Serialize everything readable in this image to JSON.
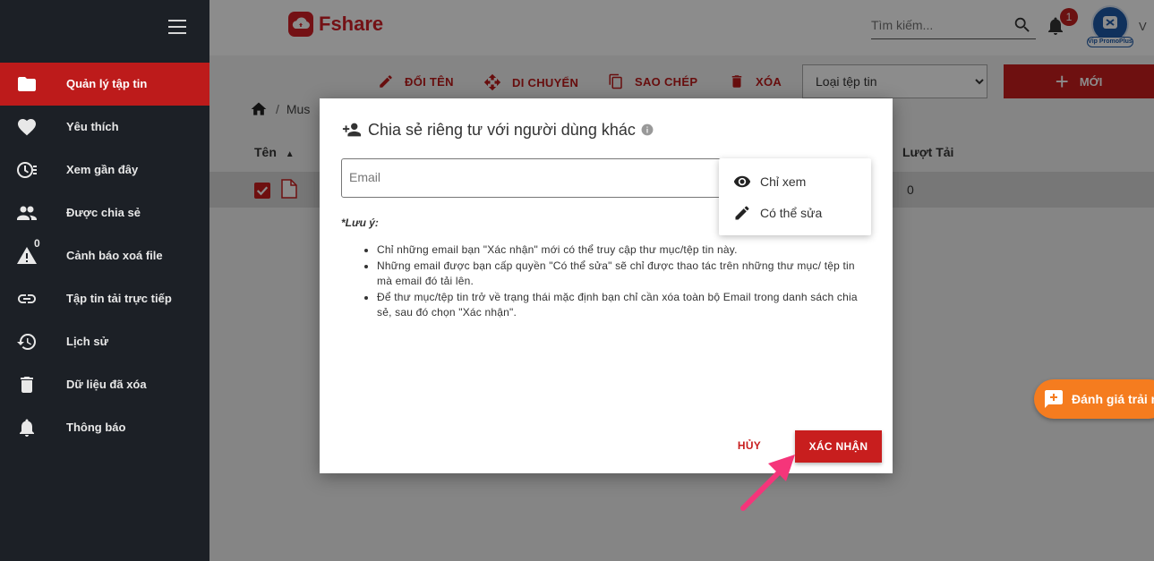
{
  "sidebar": {
    "items": [
      {
        "label": "Quản lý tập tin",
        "icon": "folder-icon",
        "active": true
      },
      {
        "label": "Yêu thích",
        "icon": "heart-icon"
      },
      {
        "label": "Xem gần đây",
        "icon": "recent-icon"
      },
      {
        "label": "Được chia sẻ",
        "icon": "people-icon"
      },
      {
        "label": "Cảnh báo xoá file",
        "icon": "warning-icon",
        "badge": "0"
      },
      {
        "label": "Tập tin tải trực tiếp",
        "icon": "link-icon"
      },
      {
        "label": "Lịch sử",
        "icon": "history-icon"
      },
      {
        "label": "Dữ liệu đã xóa",
        "icon": "trash-icon"
      },
      {
        "label": "Thông báo",
        "icon": "bell-icon"
      }
    ]
  },
  "header": {
    "brand": "Fshare",
    "search_placeholder": "Tìm kiếm...",
    "notification_count": "1",
    "vip_tag": "Vip PromoPlus",
    "edge_letter": "V"
  },
  "toolbar": {
    "rename": "ĐỔI TÊN",
    "move": "DI CHUYỂN",
    "copy": "SAO CHÉP",
    "delete": "XÓA",
    "file_type": "Loại tệp tin",
    "new": "MỚI"
  },
  "breadcrumb": {
    "folder": "Mus"
  },
  "table": {
    "col_name": "Tên",
    "col_downloads": "Lượt Tải",
    "row_downloads": "0"
  },
  "dialog": {
    "title": "Chia sẻ riêng tư với người dùng khác",
    "email_placeholder": "Email",
    "permissions": [
      "Chỉ xem",
      "Có thể sửa"
    ],
    "note_title": "*Lưu ý:",
    "notes": [
      "Chỉ những email bạn \"Xác nhận\" mới có thể truy cập thư mục/tệp tin này.",
      "Những email được bạn cấp quyền \"Có thể sửa\" sẽ chỉ được thao tác trên những thư mục/ tệp tin mà email đó tải lên.",
      "Để thư mục/tệp tin trở về trạng thái mặc định bạn chỉ cần xóa toàn bộ Email trong danh sách chia sẻ, sau đó chọn \"Xác nhận\"."
    ],
    "cancel": "HỦY",
    "confirm": "XÁC NHẬN"
  },
  "feedback": {
    "label": "Đánh giá trải ng"
  },
  "colors": {
    "brand_red": "#c81e1e",
    "sidebar_bg": "#1c2026",
    "feedback_orange": "#f57c1f",
    "arrow_pink": "#f5357a"
  }
}
